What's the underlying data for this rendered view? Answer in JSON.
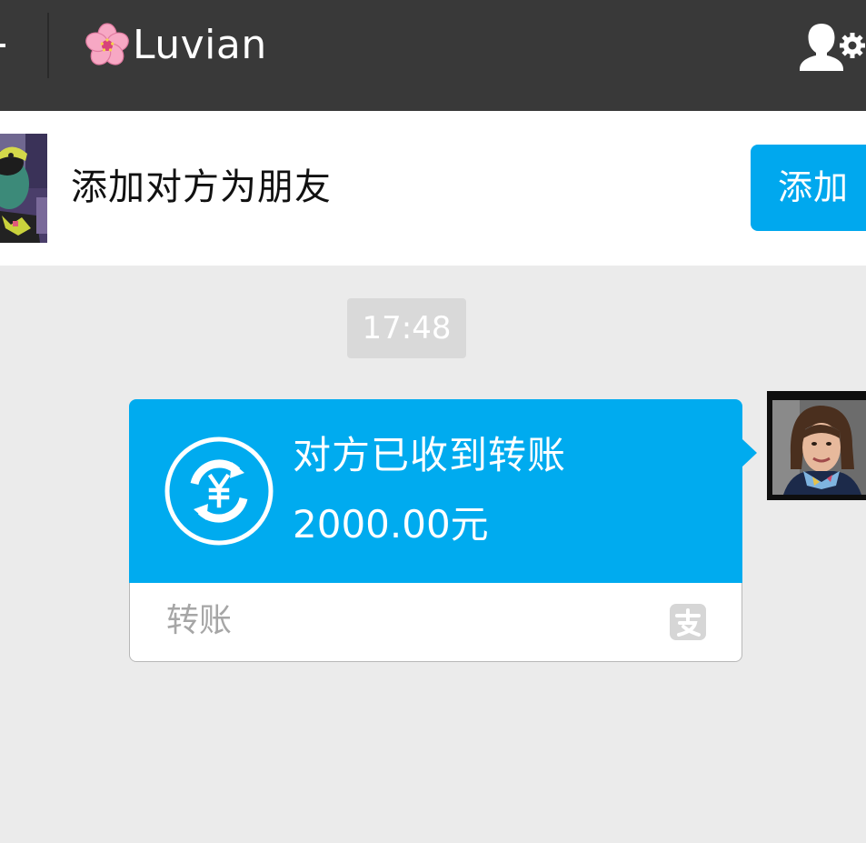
{
  "header": {
    "title": "Luvian",
    "back_icon": "back-arrow-icon",
    "title_emoji": "cherry-blossom-icon",
    "right_icon": "profile-settings-icon",
    "background_color": "#393939"
  },
  "add_friend_bar": {
    "text": "添加对方为朋友",
    "button_label": "添加",
    "button_color": "#00a8ee"
  },
  "chat": {
    "timestamp": "17:48",
    "transfer_message": {
      "status": "对方已收到转账",
      "amount": "2000.00元",
      "footer_label": "转账",
      "icon": "yuan-transfer-icon",
      "brand_icon": "alipay-icon",
      "accent_color": "#00abef"
    }
  },
  "background_color": "#ebebeb"
}
